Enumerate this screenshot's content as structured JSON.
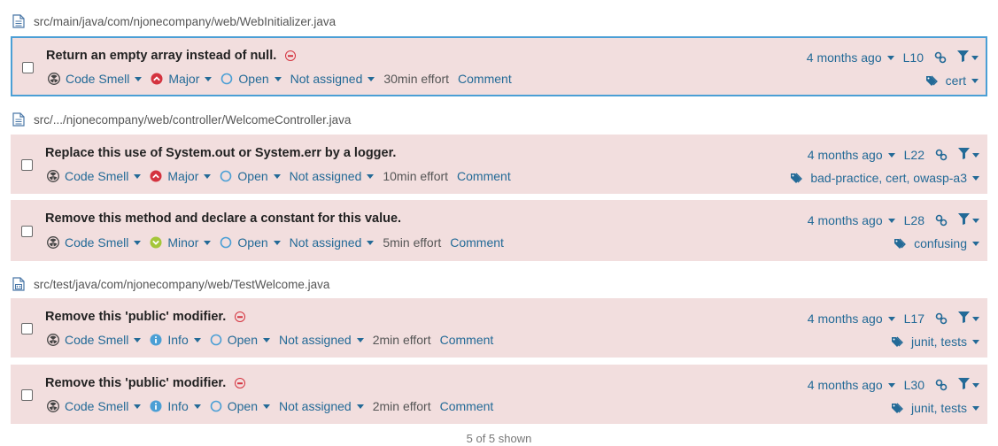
{
  "files": [
    {
      "path": "src/main/java/com/njonecompany/web/WebInitializer.java",
      "icon": "file-icon"
    },
    {
      "path": "src/.../njonecompany/web/controller/WelcomeController.java",
      "icon": "file-icon"
    },
    {
      "path": "src/test/java/com/njonecompany/web/TestWelcome.java",
      "icon": "test-file-icon"
    }
  ],
  "issues": [
    {
      "message": "Return an empty array instead of null.",
      "blocked": true,
      "type": "Code Smell",
      "severity": "Major",
      "status": "Open",
      "assignee": "Not assigned",
      "effort": "30min effort",
      "comment": "Comment",
      "date": "4 months ago",
      "line": "L10",
      "tags": "cert"
    },
    {
      "message": "Replace this use of System.out or System.err by a logger.",
      "blocked": false,
      "type": "Code Smell",
      "severity": "Major",
      "status": "Open",
      "assignee": "Not assigned",
      "effort": "10min effort",
      "comment": "Comment",
      "date": "4 months ago",
      "line": "L22",
      "tags": "bad-practice, cert, owasp-a3"
    },
    {
      "message": "Remove this method and declare a constant for this value.",
      "blocked": false,
      "type": "Code Smell",
      "severity": "Minor",
      "status": "Open",
      "assignee": "Not assigned",
      "effort": "5min effort",
      "comment": "Comment",
      "date": "4 months ago",
      "line": "L28",
      "tags": "confusing"
    },
    {
      "message": "Remove this 'public' modifier.",
      "blocked": true,
      "type": "Code Smell",
      "severity": "Info",
      "status": "Open",
      "assignee": "Not assigned",
      "effort": "2min effort",
      "comment": "Comment",
      "date": "4 months ago",
      "line": "L17",
      "tags": "junit, tests"
    },
    {
      "message": "Remove this 'public' modifier.",
      "blocked": true,
      "type": "Code Smell",
      "severity": "Info",
      "status": "Open",
      "assignee": "Not assigned",
      "effort": "2min effort",
      "comment": "Comment",
      "date": "4 months ago",
      "line": "L30",
      "tags": "junit, tests"
    }
  ],
  "footer": {
    "shown": "5 of 5 shown"
  },
  "colors": {
    "issue_bg": "#f2dede",
    "link": "#236a97",
    "selected_border": "#4b9fd5",
    "major": "#d4333f",
    "minor": "#a4c639",
    "info": "#4b9fd5"
  }
}
